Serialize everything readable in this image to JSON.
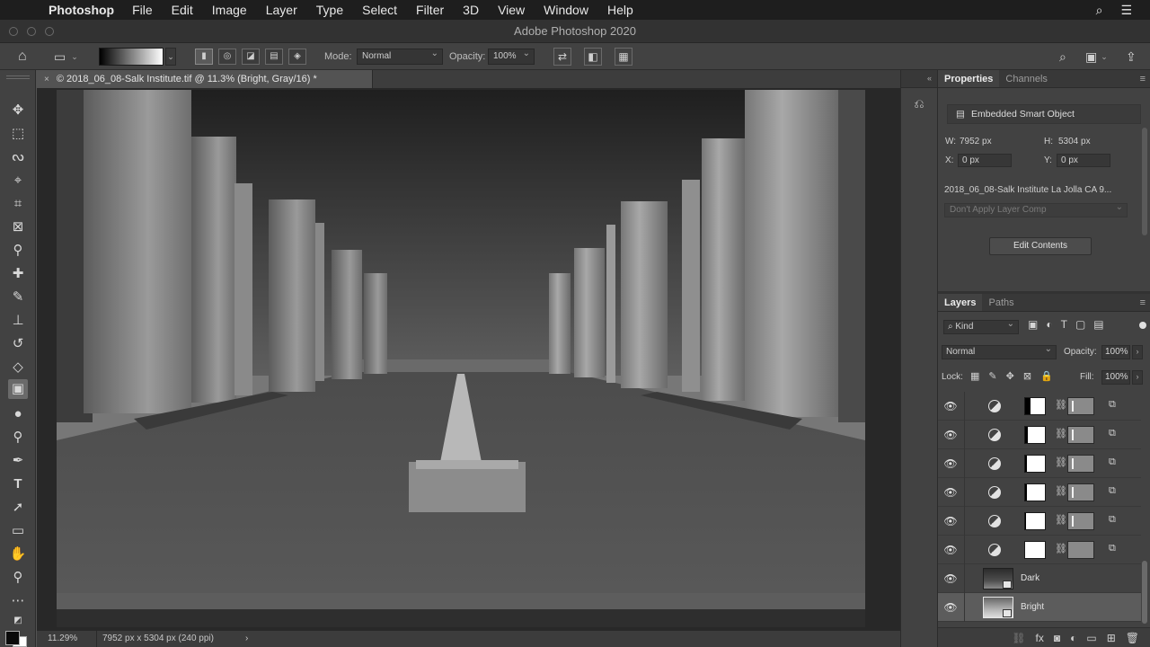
{
  "menubar": {
    "apple_glyph": "",
    "app_name": "Photoshop",
    "menus": [
      "File",
      "Edit",
      "Image",
      "Layer",
      "Type",
      "Select",
      "Filter",
      "3D",
      "View",
      "Window",
      "Help"
    ],
    "right_icons": [
      "search-icon",
      "menu-list-icon"
    ]
  },
  "window": {
    "title": "Adobe Photoshop 2020"
  },
  "options_bar": {
    "mode_label": "Mode:",
    "mode_value": "Normal",
    "opacity_label": "Opacity:",
    "opacity_value": "100%",
    "gradient_colors": [
      "#000000",
      "#ffffff"
    ]
  },
  "document": {
    "tab_title": "© 2018_06_08-Salk Institute.tif @ 11.3% (Bright, Gray/16) *",
    "close_glyph": "×",
    "zoom": "11.29%",
    "info": "7952 px x 5304 px (240 ppi)",
    "info_arrow": "›"
  },
  "properties_panel": {
    "tabs": [
      "Properties",
      "Channels"
    ],
    "object_type": "Embedded Smart Object",
    "w_label": "W:",
    "w_value": "7952 px",
    "h_label": "H:",
    "h_value": "5304 px",
    "x_label": "X:",
    "x_value": "0 px",
    "y_label": "Y:",
    "y_value": "0 px",
    "file_name": "2018_06_08-Salk Institute La Jolla CA 9...",
    "layer_comp": "Don't Apply Layer Comp",
    "edit_button": "Edit Contents"
  },
  "layers_panel": {
    "tabs": [
      "Layers",
      "Paths"
    ],
    "filter_kind": "Kind",
    "blend_mode": "Normal",
    "opacity_label": "Opacity:",
    "opacity_value": "100%",
    "lock_label": "Lock:",
    "fill_label": "Fill:",
    "fill_value": "100%",
    "layers": [
      {
        "kind": "adjustment",
        "mask_black_fraction": 0.25
      },
      {
        "kind": "adjustment",
        "mask_black_fraction": 0.12
      },
      {
        "kind": "adjustment",
        "mask_black_fraction": 0.1
      },
      {
        "kind": "adjustment",
        "mask_black_fraction": 0.08
      },
      {
        "kind": "adjustment",
        "mask_black_fraction": 0.06
      },
      {
        "kind": "adjustment",
        "mask_black_fraction": 0.0
      },
      {
        "kind": "smart",
        "name": "Dark"
      },
      {
        "kind": "smart",
        "name": "Bright",
        "selected": true
      }
    ]
  },
  "colors": {
    "accent_panel": "#424242",
    "canvas_bg": "#282828",
    "menubar_bg": "#1e1e1e"
  }
}
